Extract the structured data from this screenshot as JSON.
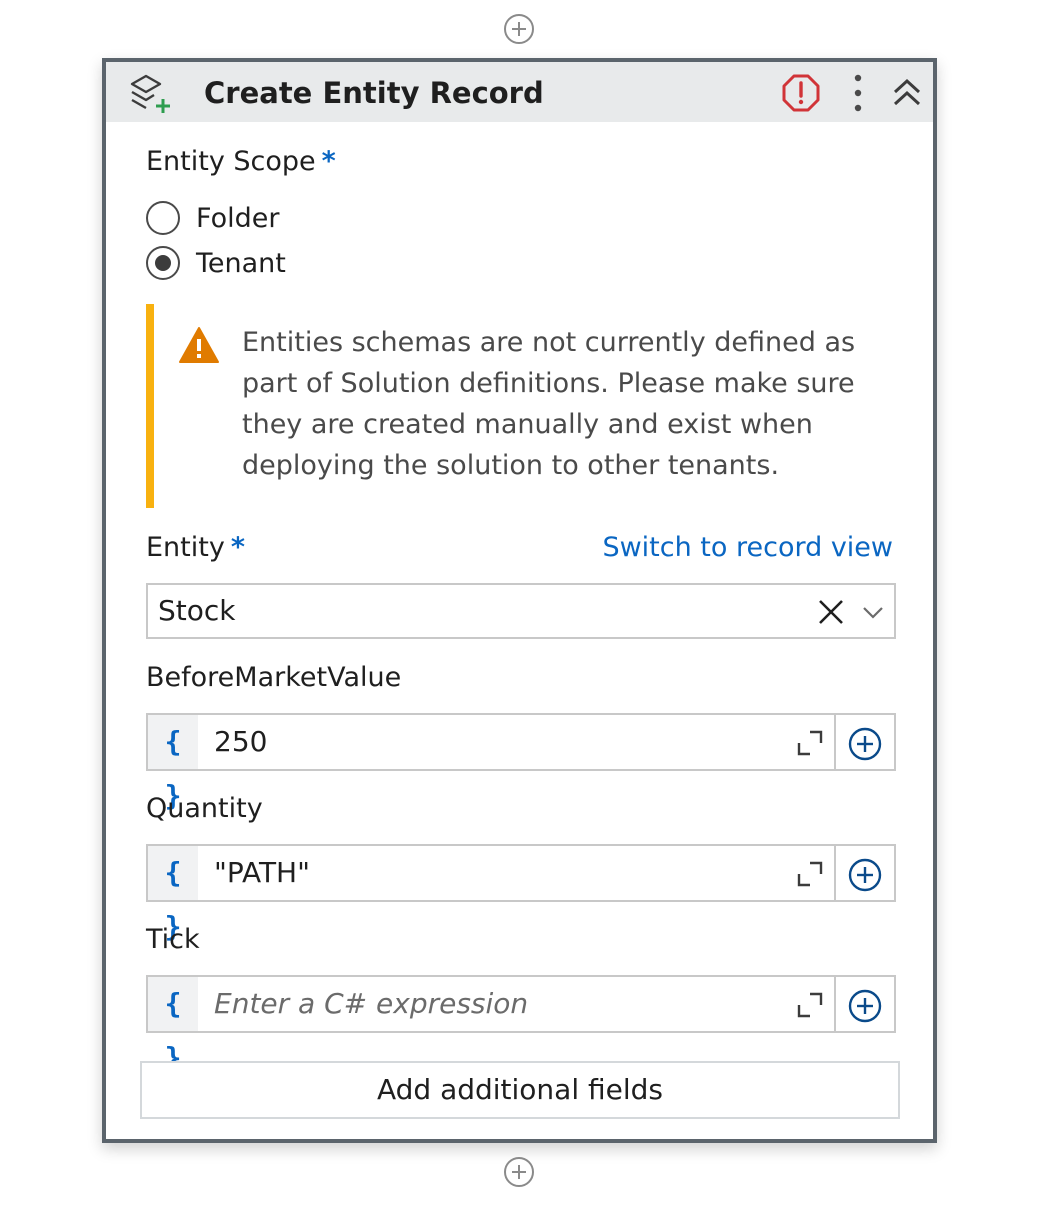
{
  "activity": {
    "title": "Create Entity Record",
    "icon": "entity-add-icon",
    "status_icon": "error-icon",
    "accent_error": "#d13438"
  },
  "scope": {
    "label": "Entity Scope",
    "required_marker": "*",
    "options": [
      {
        "label": "Folder",
        "selected": false
      },
      {
        "label": "Tenant",
        "selected": true
      }
    ]
  },
  "warning": {
    "icon": "warning-triangle-icon",
    "text": "Entities schemas are not currently defined as part of Solution definitions. Please make sure they are created manually and exist when deploying the solution to other tenants.",
    "accent": "#f8b10f"
  },
  "entity": {
    "label": "Entity",
    "required_marker": "*",
    "switch_link": "Switch to record view",
    "selected_value": "Stock"
  },
  "fields": [
    {
      "label": "BeforeMarketValue",
      "prefix": "{ }",
      "value": "250",
      "placeholder": ""
    },
    {
      "label": "Quantity",
      "prefix": "{ }",
      "value": "\"PATH\"",
      "placeholder": ""
    },
    {
      "label": "Tick",
      "prefix": "{ }",
      "value": "",
      "placeholder": "Enter a C# expression"
    }
  ],
  "add_fields_button": "Add additional fields",
  "colors": {
    "link": "#0a66c2",
    "border": "#5b646c",
    "header_bg": "#e8eaeb"
  }
}
